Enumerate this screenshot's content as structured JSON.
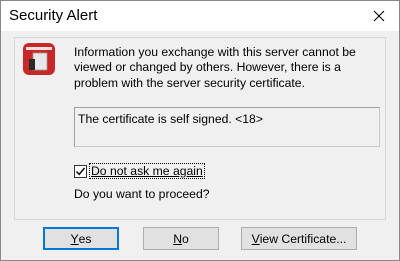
{
  "window": {
    "title": "Security Alert"
  },
  "icons": {
    "close": "close-icon",
    "app": "app-icon",
    "checkmark": "checkmark-icon"
  },
  "colors": {
    "app_icon_bg": "#c8282a",
    "default_button_border": "#0078d7"
  },
  "message": "Information you exchange with this server cannot be viewed or changed by others. However, there is a problem with the server security certificate.",
  "certificate_box": {
    "text": "The certificate is self signed. <18>"
  },
  "checkbox": {
    "label": "Do not ask me again",
    "checked": true
  },
  "question": "Do you want to proceed?",
  "buttons": {
    "yes": {
      "accel": "Y",
      "rest": "es"
    },
    "no": {
      "accel": "N",
      "rest": "o"
    },
    "view": {
      "accel": "V",
      "rest": "iew Certificate..."
    }
  }
}
